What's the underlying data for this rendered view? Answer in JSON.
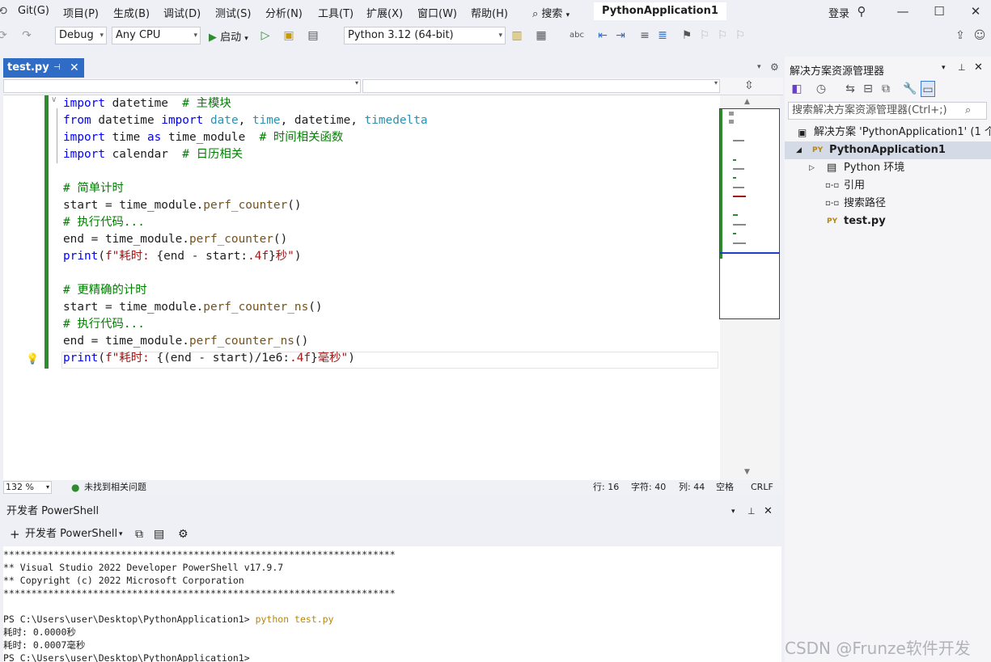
{
  "menu": [
    "Git(G)",
    "项目(P)",
    "生成(B)",
    "调试(D)",
    "测试(S)",
    "分析(N)",
    "工具(T)",
    "扩展(X)",
    "窗口(W)",
    "帮助(H)"
  ],
  "search_label": "搜索",
  "app_title": "PythonApplication1",
  "login_label": "登录",
  "toolbar": {
    "config": "Debug",
    "platform": "Any CPU",
    "start_label": "启动",
    "python_env": "Python 3.12 (64-bit)"
  },
  "editor": {
    "tab_name": "test.py",
    "lines": [
      [
        [
          "kw",
          "import"
        ],
        [
          "t",
          " datetime  "
        ],
        [
          "cm",
          "# 主模块"
        ]
      ],
      [
        [
          "kw",
          "from"
        ],
        [
          "t",
          " datetime "
        ],
        [
          "kw",
          "import"
        ],
        [
          "t",
          " "
        ],
        [
          "tp",
          "date"
        ],
        [
          "t",
          ", "
        ],
        [
          "tp",
          "time"
        ],
        [
          "t",
          ", datetime, "
        ],
        [
          "tp",
          "timedelta"
        ]
      ],
      [
        [
          "kw",
          "import"
        ],
        [
          "t",
          " time "
        ],
        [
          "kw",
          "as"
        ],
        [
          "t",
          " time_module  "
        ],
        [
          "cm",
          "# 时间相关函数"
        ]
      ],
      [
        [
          "kw",
          "import"
        ],
        [
          "t",
          " calendar  "
        ],
        [
          "cm",
          "# 日历相关"
        ]
      ],
      [
        [
          "t",
          ""
        ]
      ],
      [
        [
          "cm",
          "# 简单计时"
        ]
      ],
      [
        [
          "t",
          "start = time_module."
        ],
        [
          "fn",
          "perf_counter"
        ],
        [
          "t",
          "()"
        ]
      ],
      [
        [
          "cm",
          "# 执行代码..."
        ]
      ],
      [
        [
          "t",
          "end = time_module."
        ],
        [
          "fn",
          "perf_counter"
        ],
        [
          "t",
          "()"
        ]
      ],
      [
        [
          "kw",
          "print"
        ],
        [
          "t",
          "("
        ],
        [
          "st",
          "f\"耗时: "
        ],
        [
          "t",
          "{end - start:"
        ],
        [
          "st",
          ".4f"
        ],
        [
          "t",
          "}"
        ],
        [
          "st",
          "秒\""
        ],
        [
          "t",
          ")"
        ]
      ],
      [
        [
          "t",
          ""
        ]
      ],
      [
        [
          "cm",
          "# 更精确的计时"
        ]
      ],
      [
        [
          "t",
          "start = time_module."
        ],
        [
          "fn",
          "perf_counter_ns"
        ],
        [
          "t",
          "()"
        ]
      ],
      [
        [
          "cm",
          "# 执行代码..."
        ]
      ],
      [
        [
          "t",
          "end = time_module."
        ],
        [
          "fn",
          "perf_counter_ns"
        ],
        [
          "t",
          "()"
        ]
      ],
      [
        [
          "kw",
          "print"
        ],
        [
          "t",
          "("
        ],
        [
          "st",
          "f\"耗时: "
        ],
        [
          "t",
          "{(end - start)/1e6:"
        ],
        [
          "st",
          ".4f"
        ],
        [
          "t",
          "}"
        ],
        [
          "st",
          "毫秒\""
        ],
        [
          "t",
          ")"
        ]
      ]
    ]
  },
  "status": {
    "zoom": "132 %",
    "issues": "未找到相关问题",
    "line": "行: 16",
    "char": "字符: 40",
    "col": "列: 44",
    "spacing": "空格",
    "eol": "CRLF"
  },
  "terminal": {
    "title": "开发者 PowerShell",
    "tab_label": "开发者 PowerShell",
    "banner_rule": "**********************************************************************",
    "banner_1": "** Visual Studio 2022 Developer PowerShell v17.9.7",
    "banner_2": "** Copyright (c) 2022 Microsoft Corporation",
    "prompt": "PS C:\\Users\\user\\Desktop\\PythonApplication1> ",
    "command": "python test.py",
    "out_1": "耗时: 0.0000秒",
    "out_2": "耗时: 0.0007毫秒",
    "prompt_2": "PS C:\\Users\\user\\Desktop\\PythonApplication1>"
  },
  "solution": {
    "title": "解决方案资源管理器",
    "search_placeholder": "搜索解决方案资源管理器(Ctrl+;)",
    "items": [
      {
        "label": "解决方案 'PythonApplication1' (1 个"
      },
      {
        "label": "PythonApplication1"
      },
      {
        "label": "Python 环境"
      },
      {
        "label": "引用"
      },
      {
        "label": "搜索路径"
      },
      {
        "label": "test.py"
      }
    ]
  },
  "watermark": "CSDN @Frunze软件开发"
}
